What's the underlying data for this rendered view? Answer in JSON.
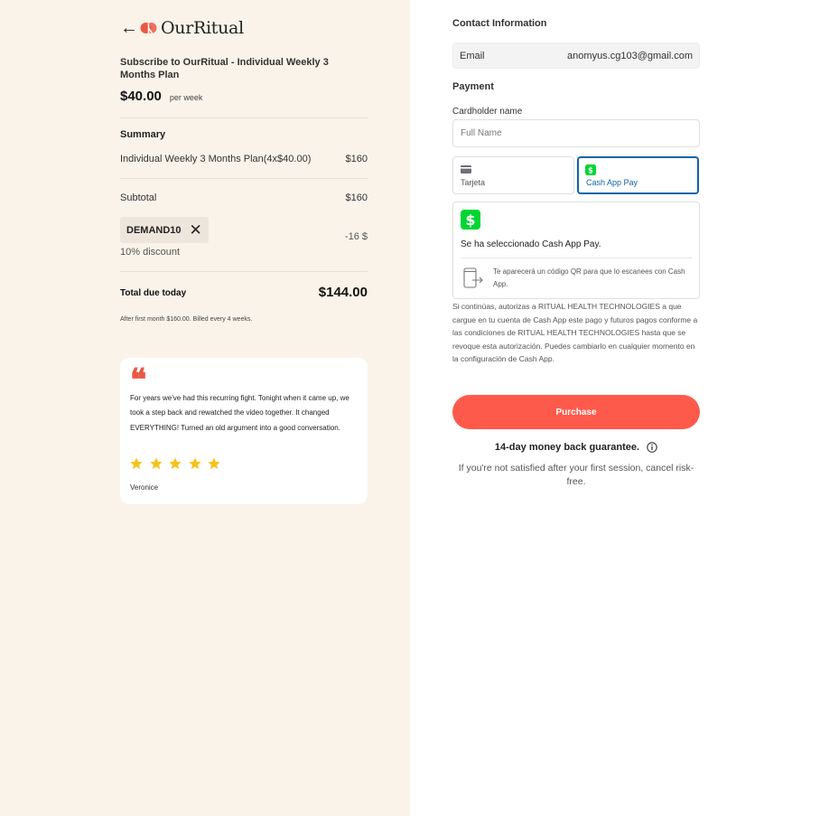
{
  "brand": {
    "name": "OurRitual",
    "back_arrow": "←"
  },
  "order": {
    "product_title": "Subscribe to OurRitual - Individual Weekly 3 Months Plan",
    "price": "$40.00",
    "price_period": "per week",
    "summary_title": "Summary",
    "line_item": {
      "label": "Individual Weekly 3 Months Plan(4x$40.00)",
      "amount": "$160"
    },
    "subtotal": {
      "label": "Subtotal",
      "amount": "$160"
    },
    "coupon": {
      "code": "DEMAND10",
      "remove_icon": "✕"
    },
    "discount": {
      "label": "10% discount",
      "amount": "-16 $"
    },
    "total": {
      "label": "Total due today",
      "amount": "$144.00"
    },
    "after_note": "After first month $160.00. Billed every 4 weeks."
  },
  "review": {
    "quote_mark": "❝",
    "text": "For years we've had this recurring fight. Tonight when it came up, we took a step back and rewatched the video together. It changed EVERYTHING! Turned an old argument into a good conversation.",
    "rating": 5,
    "reviewer": "Veronice"
  },
  "checkout": {
    "contact_title": "Contact Information",
    "email_label": "Email",
    "email_value": "anomyus.cg103@gmail.com",
    "payment_title": "Payment",
    "cardholder_label": "Cardholder name",
    "cardholder_placeholder": "Full Name",
    "methods": [
      {
        "label": "Tarjeta",
        "icon": "card-icon",
        "selected": false
      },
      {
        "label": "Cash App Pay",
        "icon": "cash-app-icon",
        "selected": true
      }
    ],
    "cashapp_selected_text": "Se ha seleccionado Cash App Pay.",
    "cashapp_qr_text": "Te aparecerá un código QR para que lo escanees con Cash App.",
    "consent_text": "Si continúas, autorizas a RITUAL HEALTH TECHNOLOGIES a que cargue en tu cuenta de Cash App este pago y futuros pagos conforme a las condiciones de RITUAL HEALTH TECHNOLOGIES hasta que se revoque esta autorización. Puedes cambiarlo en cualquier momento en la configuración de Cash App.",
    "purchase_label": "Purchase",
    "guarantee_title": "14-day money back guarantee.",
    "guarantee_sub": "If you're not satisfied after your first session, cancel risk-free."
  },
  "colors": {
    "left_bg": "#f9f3ea",
    "accent": "#fe5a4c",
    "cash_app_green": "#00d632",
    "selected_border": "#0f64a8",
    "star": "#f7c21b"
  }
}
